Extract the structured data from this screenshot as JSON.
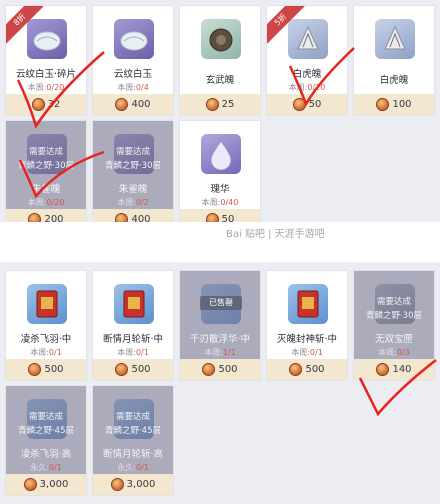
{
  "top": {
    "items": [
      {
        "name": "云纹白玉·碎片",
        "limit_label": "本周:",
        "limit_value": "0/20",
        "price": "32",
        "badge": "8折",
        "icon": "jade-shard-icon",
        "locked": false
      },
      {
        "name": "云纹白玉",
        "limit_label": "本周:",
        "limit_value": "0/4",
        "price": "400",
        "icon": "jade-shard-icon",
        "locked": false
      },
      {
        "name": "玄武魄",
        "limit_label": "",
        "limit_value": "",
        "price": "25",
        "icon": "tortoise-soul-icon",
        "locked": false
      },
      {
        "name": "白虎魄",
        "limit_label": "本周:",
        "limit_value": "0/20",
        "price": "50",
        "badge": "5折",
        "icon": "tiger-soul-icon",
        "locked": false
      },
      {
        "name": "白虎魄",
        "limit_label": "",
        "limit_value": "",
        "price": "100",
        "icon": "tiger-soul-icon",
        "locked": false
      },
      {
        "name": "朱雀魄",
        "limit_label": "本周:",
        "limit_value": "0/20",
        "price": "200",
        "icon": "phoenix-soul-icon",
        "locked": true,
        "req_line1": "需要达成",
        "req_line2": "青麟之野·30层"
      },
      {
        "name": "朱雀魄",
        "limit_label": "本周:",
        "limit_value": "0/2",
        "price": "400",
        "icon": "phoenix-soul-icon",
        "locked": true,
        "req_line1": "需要达成",
        "req_line2": "青麟之野·30层"
      },
      {
        "name": "瑰华",
        "limit_label": "本周:",
        "limit_value": "0/40",
        "price": "50",
        "icon": "droplet-icon",
        "locked": false
      }
    ]
  },
  "watermark": "Bai 贴吧 | 天涯手游吧",
  "bottom": {
    "items": [
      {
        "name": "凌杀飞羽·中",
        "limit_label": "本周:",
        "limit_value": "0/1",
        "price": "500",
        "icon": "book-icon",
        "locked": false
      },
      {
        "name": "断情月轮斩·中",
        "limit_label": "本周:",
        "limit_value": "0/1",
        "price": "500",
        "icon": "book-icon",
        "locked": false
      },
      {
        "name": "千刃散浮华·中",
        "limit_label": "本周:",
        "limit_value": "1/1",
        "price": "500",
        "icon": "book-icon",
        "locked": false,
        "sold": "已售罄"
      },
      {
        "name": "灭魄封神斩·中",
        "limit_label": "本周:",
        "limit_value": "0/1",
        "price": "500",
        "icon": "book-icon",
        "locked": false
      },
      {
        "name": "无双宝匣",
        "limit_label": "本周:",
        "limit_value": "0/3",
        "price": "140",
        "icon": "treasure-box-icon",
        "locked": true,
        "req_line1": "需要达成",
        "req_line2": "青麟之野·30层"
      },
      {
        "name": "凌杀飞羽·高",
        "limit_label": "永久:",
        "limit_value": "0/1",
        "price": "3,000",
        "icon": "book-icon",
        "locked": true,
        "req_line1": "需要达成",
        "req_line2": "青麟之野·45层"
      },
      {
        "name": "断情月轮斩·高",
        "limit_label": "永久:",
        "limit_value": "0/1",
        "price": "3,000",
        "icon": "book-icon",
        "locked": true,
        "req_line1": "需要达成",
        "req_line2": "青麟之野·45层"
      }
    ]
  },
  "colors": {
    "badge": "#cf4444",
    "price_bg": "#f3e7d0",
    "limit_value": "#d4584b",
    "annotation": "#e8231e"
  }
}
